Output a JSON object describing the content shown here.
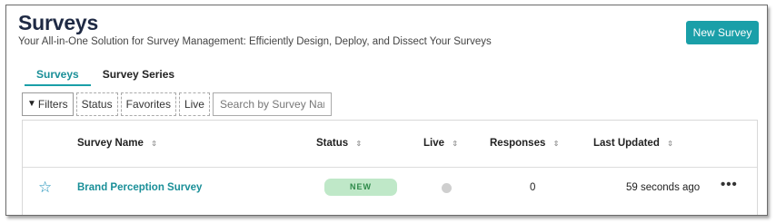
{
  "header": {
    "title": "Surveys",
    "subtitle": "Your All-in-One Solution for Survey Management: Efficiently Design, Deploy, and Dissect Your Surveys",
    "new_button_label": "New Survey"
  },
  "tabs": [
    {
      "label": "Surveys",
      "active": true
    },
    {
      "label": "Survey Series",
      "active": false
    }
  ],
  "filters": {
    "filters_label": "Filters",
    "filters_icon": "funnel-icon",
    "chips": [
      "Status",
      "Favorites",
      "Live"
    ],
    "search_placeholder": "Search by Survey Name",
    "search_value": ""
  },
  "table": {
    "columns": [
      "Survey Name",
      "Status",
      "Live",
      "Responses",
      "Last Updated"
    ],
    "sort_icon": "sort-updown-icon",
    "rows": [
      {
        "favorite_icon": "star-outline-icon",
        "name": "Brand Perception Survey",
        "status": "NEW",
        "live": false,
        "responses": "0",
        "last_updated": "59 seconds ago",
        "menu_label": "•••"
      }
    ]
  },
  "colors": {
    "accent": "#1a9fa8",
    "title": "#1f2a44",
    "status_new_bg": "#bfe8c8",
    "status_new_text": "#2e8a4a",
    "live_off": "#cfcfcf"
  }
}
